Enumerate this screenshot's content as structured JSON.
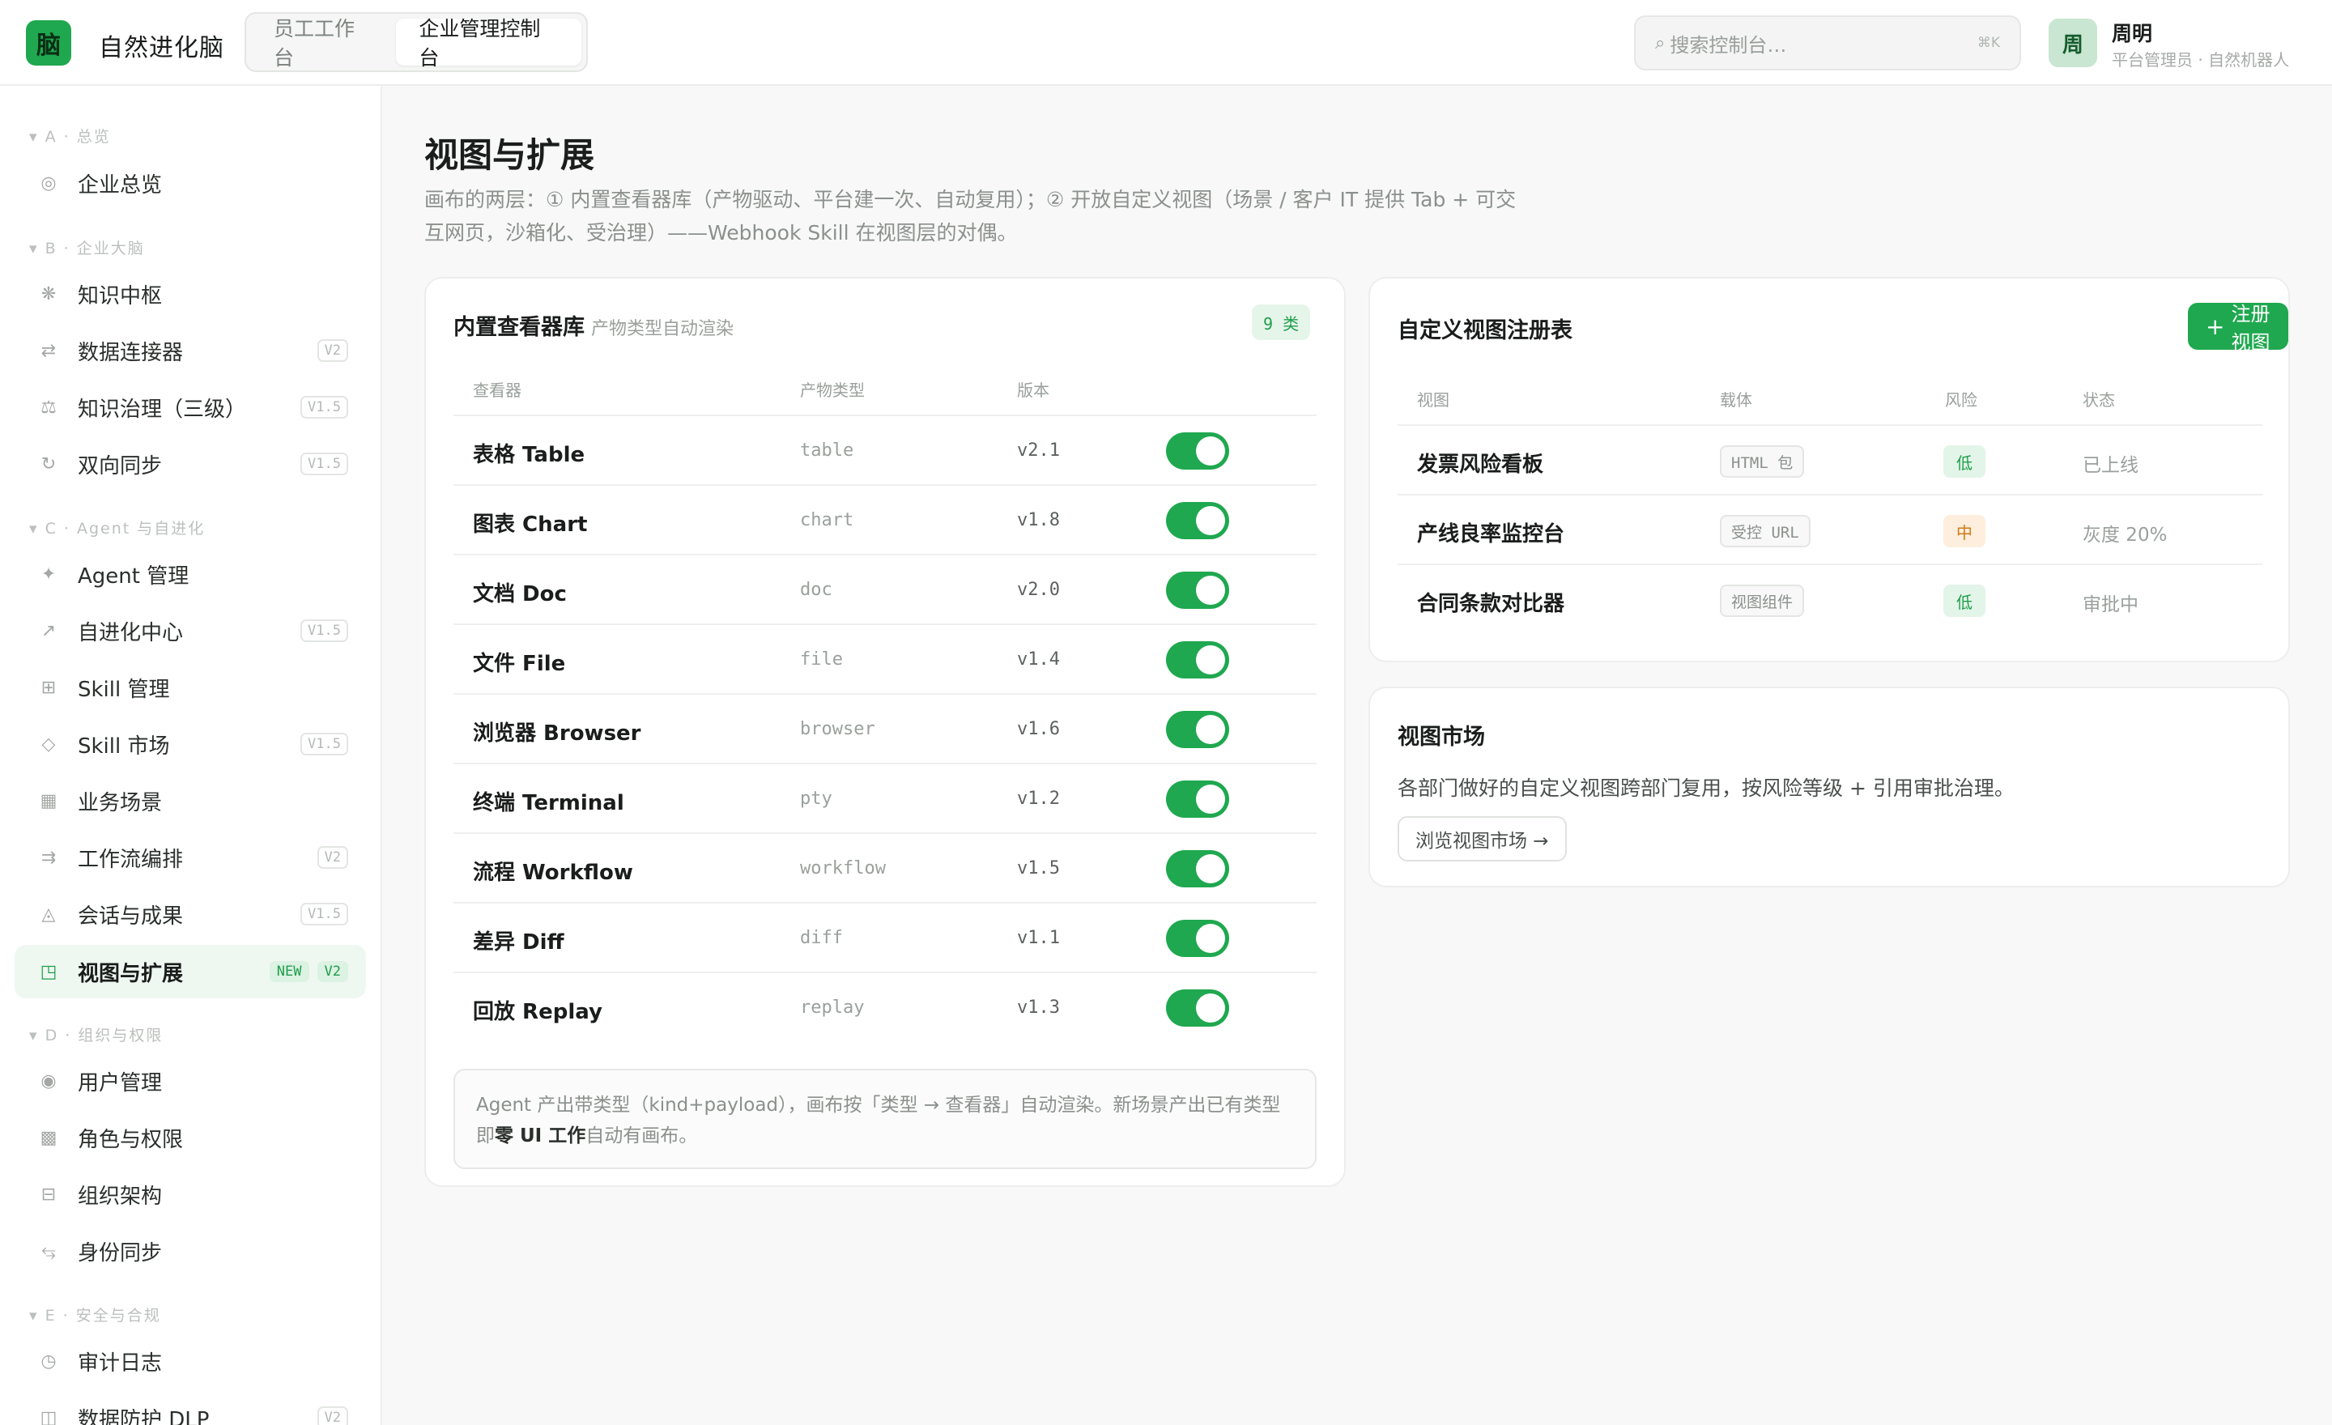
{
  "header": {
    "logo_char": "脑",
    "app_title": "自然进化脑",
    "tabs": [
      {
        "label": "员工工作台",
        "active": false
      },
      {
        "label": "企业管理控制台",
        "active": true
      }
    ],
    "search": {
      "icon": "⌕",
      "placeholder": "搜索控制台…",
      "shortcut": "⌘K"
    },
    "user": {
      "avatar_char": "周",
      "name": "周明",
      "subtitle": "平台管理员 · 自然机器人"
    }
  },
  "sidebar": {
    "groups": [
      {
        "label": "▾ A · 总览"
      },
      {
        "label": "▾ B · 企业大脑"
      },
      {
        "label": "▾ C · Agent 与自进化"
      },
      {
        "label": "▾ D · 组织与权限"
      },
      {
        "label": "▾ E · 安全与合规"
      }
    ],
    "items": [
      {
        "icon": "◎",
        "label": "企业总览",
        "tag": ""
      },
      {
        "icon": "❋",
        "label": "知识中枢",
        "tag": ""
      },
      {
        "icon": "⇄",
        "label": "数据连接器",
        "tag": "V2"
      },
      {
        "icon": "⚖",
        "label": "知识治理（三级）",
        "tag": "V1.5"
      },
      {
        "icon": "↻",
        "label": "双向同步",
        "tag": "V1.5"
      },
      {
        "icon": "✦",
        "label": "Agent 管理",
        "tag": ""
      },
      {
        "icon": "↗",
        "label": "自进化中心",
        "tag": "V1.5"
      },
      {
        "icon": "⊞",
        "label": "Skill 管理",
        "tag": ""
      },
      {
        "icon": "◇",
        "label": "Skill 市场",
        "tag": "V1.5"
      },
      {
        "icon": "▦",
        "label": "业务场景",
        "tag": ""
      },
      {
        "icon": "⇉",
        "label": "工作流编排",
        "tag": "V2"
      },
      {
        "icon": "◬",
        "label": "会话与成果",
        "tag": "V1.5"
      },
      {
        "icon": "◳",
        "label": "视图与扩展",
        "tag_new": "NEW",
        "tag": "V2",
        "active": true
      },
      {
        "icon": "◉",
        "label": "用户管理",
        "tag": ""
      },
      {
        "icon": "▩",
        "label": "角色与权限",
        "tag": ""
      },
      {
        "icon": "⊟",
        "label": "组织架构",
        "tag": ""
      },
      {
        "icon": "⥃",
        "label": "身份同步",
        "tag": ""
      },
      {
        "icon": "◷",
        "label": "审计日志",
        "tag": ""
      },
      {
        "icon": "◫",
        "label": "数据防护 DLP",
        "tag": "V2"
      }
    ]
  },
  "main": {
    "title": "视图与扩展",
    "description": "画布的两层：① 内置查看器库（产物驱动、平台建一次、自动复用）；② 开放自定义视图（场景 / 客户 IT 提供 Tab + 可交互网页，沙箱化、受治理）——Webhook Skill 在视图层的对偶。"
  },
  "viewers": {
    "title": "内置查看器库",
    "subtitle": "产物类型自动渲染",
    "count_badge": "9 类",
    "columns": [
      "查看器",
      "产物类型",
      "版本"
    ],
    "rows": [
      {
        "name": "表格 Table",
        "kind": "table",
        "version": "v2.1",
        "enabled": true
      },
      {
        "name": "图表 Chart",
        "kind": "chart",
        "version": "v1.8",
        "enabled": true
      },
      {
        "name": "文档 Doc",
        "kind": "doc",
        "version": "v2.0",
        "enabled": true
      },
      {
        "name": "文件 File",
        "kind": "file",
        "version": "v1.4",
        "enabled": true
      },
      {
        "name": "浏览器 Browser",
        "kind": "browser",
        "version": "v1.6",
        "enabled": true
      },
      {
        "name": "终端 Terminal",
        "kind": "pty",
        "version": "v1.2",
        "enabled": true
      },
      {
        "name": "流程 Workflow",
        "kind": "workflow",
        "version": "v1.5",
        "enabled": true
      },
      {
        "name": "差异 Diff",
        "kind": "diff",
        "version": "v1.1",
        "enabled": true
      },
      {
        "name": "回放 Replay",
        "kind": "replay",
        "version": "v1.3",
        "enabled": true
      }
    ],
    "note_part1": "Agent 产出带类型（kind+payload），画布按「类型 → 查看器」自动渲染。新场景产出已有类型即",
    "note_bold": "零 UI 工作",
    "note_part2": "自动有画布。"
  },
  "registry": {
    "title": "自定义视图注册表",
    "register_button": "注册视图",
    "columns": [
      "视图",
      "载体",
      "风险",
      "状态"
    ],
    "rows": [
      {
        "name": "发票风险看板",
        "carrier": "HTML 包",
        "risk": "低",
        "risk_level": "low",
        "status": "已上线"
      },
      {
        "name": "产线良率监控台",
        "carrier": "受控 URL",
        "risk": "中",
        "risk_level": "mid",
        "status": "灰度 20%"
      },
      {
        "name": "合同条款对比器",
        "carrier": "视图组件",
        "risk": "低",
        "risk_level": "low",
        "status": "审批中"
      }
    ]
  },
  "market": {
    "title": "视图市场",
    "description": "各部门做好的自定义视图跨部门复用，按风险等级 + 引用审批治理。",
    "button": "浏览视图市场 →"
  },
  "colors": {
    "accent": "#1fa84f",
    "accent_soft": "#e6f5ea",
    "risk_mid": "#d07a16"
  }
}
